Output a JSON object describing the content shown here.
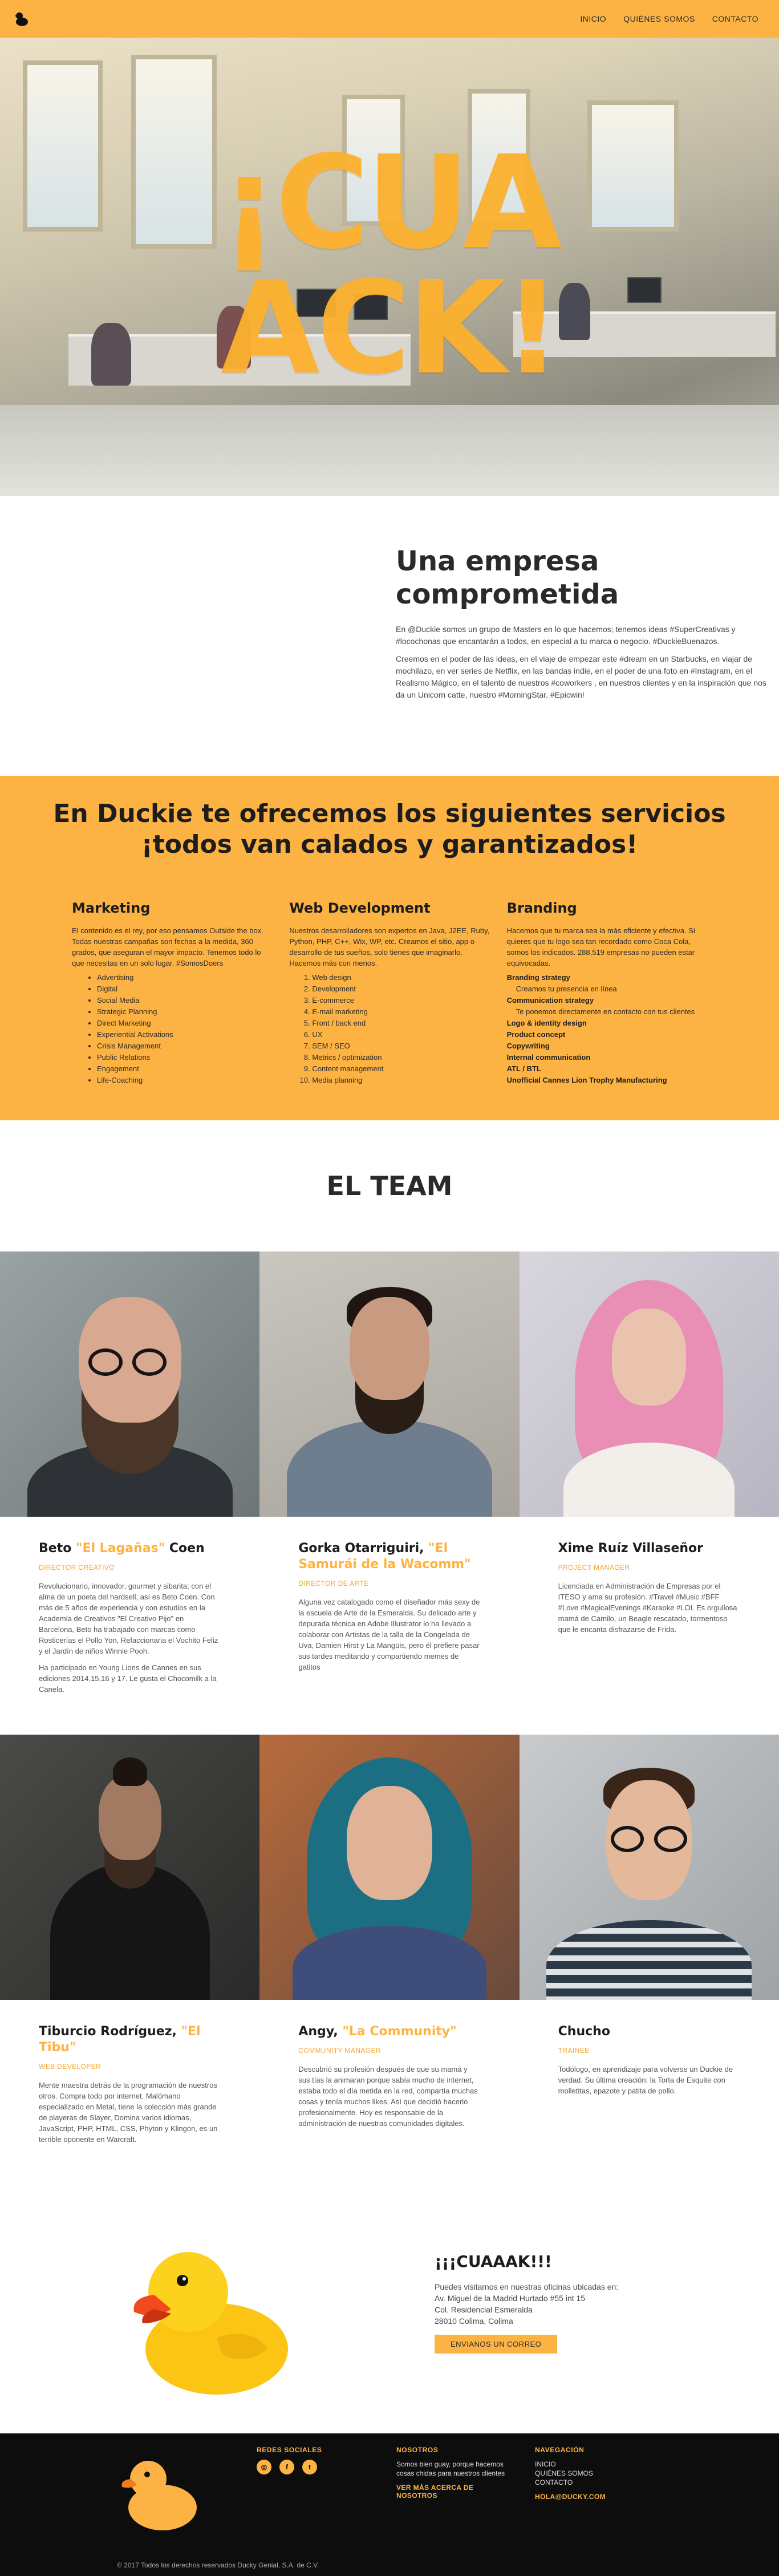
{
  "nav": {
    "items": [
      "INICIO",
      "QUIÉNES SOMOS",
      "CONTACTO"
    ]
  },
  "hero": {
    "headline_1": "¡CUA",
    "headline_2": "ACK!"
  },
  "about": {
    "title": "Una empresa comprometida",
    "p1": "En @Duckie somos un grupo de Masters en lo que hacemos; tenemos ideas #SuperCreativas y #locochonas que encantarán a todos, en especial a tu marca o negocio. #DuckieBuenazos.",
    "p2": "Creemos en el poder de las ideas, en el viaje de empezar este #dream en un Starbucks, en viajar de mochilazo, en ver series de Netflix, en las bandas indie, en el poder de una foto en #Instagram, en el Realismo Mágico, en el talento de nuestros #coworkers , en nuestros clientes y en la inspiración que nos da un Unicorn catte, nuestro #MorningStar. #Epicwin!"
  },
  "services": {
    "title": "En Duckie te ofrecemos los siguientes servicios ¡todos van calados y garantizados!",
    "marketing": {
      "title": "Marketing",
      "desc": "El contenido es el rey, por eso pensamos Outside the box. Todas nuestras campañas son fechas a la medida, 360 grados, que aseguran el mayor impacto. Tenemos todo lo que necesitas en un solo lugar. #SomosDoers",
      "items": [
        "Advertising",
        "Digital",
        "Social Media",
        "Strategic Planning",
        "Direct Marketing",
        "Experiential Activations",
        "Crisis Management",
        "Public Relations",
        "Engagement",
        "Life-Coaching"
      ]
    },
    "web": {
      "title": "Web Development",
      "desc": "Nuestros desarrolladores son expertos en Java, J2EE, Ruby, Python, PHP, C++, Wix, WP, etc. Creamos el sitio, app o desarrollo de tus sueños, solo tienes que imaginarlo. Hacemos más con menos.",
      "items": [
        "Web design",
        "Development",
        "E-commerce",
        "E-mail marketing",
        "Front / back end",
        "UX",
        "SEM / SEO",
        "Metrics / optimization",
        "Content management",
        "Media planning"
      ]
    },
    "branding": {
      "title": "Branding",
      "desc": "Hacemos que tu marca sea la más eficiente y efectiva. Si quieres que tu logo sea tan recordado como Coca Cola, somos los indicados. 288,519 empresas no pueden estar equivocadas.",
      "b1": "Branding strategy",
      "s1": "Creamos tu presencia en línea",
      "b2": "Communication strategy",
      "s2": "Te ponemos directamente en contacto con tus clientes",
      "rest": [
        "Logo & identity design",
        "Product concept",
        "Copywriting",
        "Internal communication",
        "ATL / BTL",
        "Unofficial Cannes Lion Trophy Manufacturing"
      ]
    }
  },
  "team": {
    "title": "EL TEAM",
    "members": [
      {
        "first": "Beto ",
        "nick": "\"El Lagañas\"",
        "last": " Coen",
        "role": "DIRECTOR CREATIVO",
        "p1": "Revolucionario, innovador, gourmet y sibarita; con el alma de un poeta del hardsell, así es Beto Coen. Con más de 5 años de experiencia y con estudios en la Academia de Creativos \"El Creativo Pijo\" en Barcelona, Beto ha trabajado con marcas como Rosticerías el Pollo Yon, Refaccionaria el Vochito Feliz y el Jardín de niños Winnie Pooh.",
        "p2": "Ha participado en Young Lions de Cannes en sus ediciones 2014,15,16 y 17. Le gusta el Chocomilk a la Canela."
      },
      {
        "first": "Gorka Otarriguiri, ",
        "nick": "\"El Samurái de la Wacomm\"",
        "last": "",
        "role": "DIRECTOR DE ARTE",
        "p1": "Alguna vez catalogado como el diseñador más sexy de la escuela de Arte de la Esmeralda. Su delicado arte y depurada técnica en Adobe Illustrator lo ha llevado a colaborar con Artistas de la talla de la Congelada de Uva, Damien Hirst y La Mangüis, pero él prefiere pasar sus tardes meditando y compartiendo memes de gatitos",
        "p2": ""
      },
      {
        "first": "Xime Ruíz Villaseñor",
        "nick": "",
        "last": "",
        "role": "PROJECT MANAGER",
        "p1": "Licenciada en Administración de Empresas por el ITESO y ama su profesión. #Travel #Music #BFF #Love #MagicalEvenings #Karaoke #LOL Es orgullosa mamá de Camilo, un Beagle rescatado, tormentoso que le encanta disfrazarse de Frida.",
        "p2": ""
      },
      {
        "first": "Tiburcio Rodríguez, ",
        "nick": "\"El Tibu\"",
        "last": "",
        "role": "WEB DEVELOPER",
        "p1": "Mente maestra detrás de la programación de nuestros otros. Compra todo por internet, Malómano especializado en Metal, tiene la colección más grande de playeras de Slayer, Domina varios idiomas, JavaScript, PHP, HTML, CSS, Phyton y Klingon, es un terrible oponente en Warcraft.",
        "p2": ""
      },
      {
        "first": "Angy, ",
        "nick": "\"La Community\"",
        "last": "",
        "role": "COMMUNITY MANAGER",
        "p1": "Descubrió su profesión después de que su mamá y sus tías la animaran porque sabía mucho de internet, estaba todo el día metida en la red, compartía muchas cosas y tenía muchos likes. Así que decidió hacerlo profesionalmente. Hoy es responsable de la administración de nuestras comunidades digitales.",
        "p2": ""
      },
      {
        "first": "Chucho",
        "nick": "",
        "last": "",
        "role": "TRAINEE",
        "p1": "Todólogo, en aprendizaje para volverse un Duckie de verdad. Su última creación: la Torta de Esquite con molletitas, epazote y patita de pollo.",
        "p2": ""
      }
    ]
  },
  "contact": {
    "title": "¡¡¡CUAAAK!!!",
    "line1": "Puedes visitarnos en nuestras oficinas ubicadas en:",
    "line2": "Av. Miguel de la Madrid Hurtado #55 int 15",
    "line3": "Col. Residencial Esmeralda",
    "line4": "28010 Colima, Colima",
    "button": "ENVIANOS UN CORREO"
  },
  "footer": {
    "social_title": "REDES SOCIALES",
    "social": [
      "◎",
      "f",
      "t"
    ],
    "about_title": "NOSOTROS",
    "about_text": "Somos bien guay, porque hacemos cosas chidas para nuestros clientes",
    "about_more": "VER MÁS ACERCA DE NOSOTROS",
    "nav_title": "NAVEGACIÓN",
    "nav_items": [
      "INICIO",
      "QUIÉNES SOMOS",
      "CONTACTO"
    ],
    "email": "HOLA@DUCKY.COM",
    "copyright": "© 2017 Todos los derechos reservados Ducky Genial, S.A. de C.V."
  },
  "colors": {
    "accent": "#fdb344",
    "dark": "#0d0d0d"
  }
}
